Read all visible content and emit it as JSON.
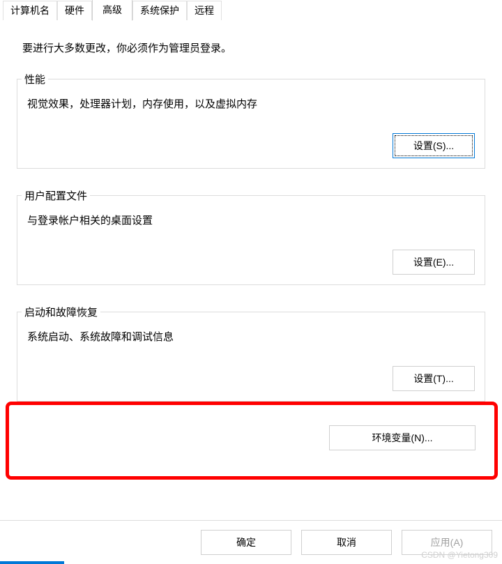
{
  "tabs": {
    "computerName": "计算机名",
    "hardware": "硬件",
    "advanced": "高级",
    "systemProtection": "系统保护",
    "remote": "远程"
  },
  "intro": "要进行大多数更改，你必须作为管理员登录。",
  "performance": {
    "legend": "性能",
    "desc": "视觉效果，处理器计划，内存使用，以及虚拟内存",
    "button": "设置(S)..."
  },
  "userProfiles": {
    "legend": "用户配置文件",
    "desc": "与登录帐户相关的桌面设置",
    "button": "设置(E)..."
  },
  "startupRecovery": {
    "legend": "启动和故障恢复",
    "desc": "系统启动、系统故障和调试信息",
    "button": "设置(T)..."
  },
  "envVarsButton": "环境变量(N)...",
  "footer": {
    "ok": "确定",
    "cancel": "取消",
    "apply": "应用(A)"
  },
  "watermark": "CSDN @Yietong309"
}
